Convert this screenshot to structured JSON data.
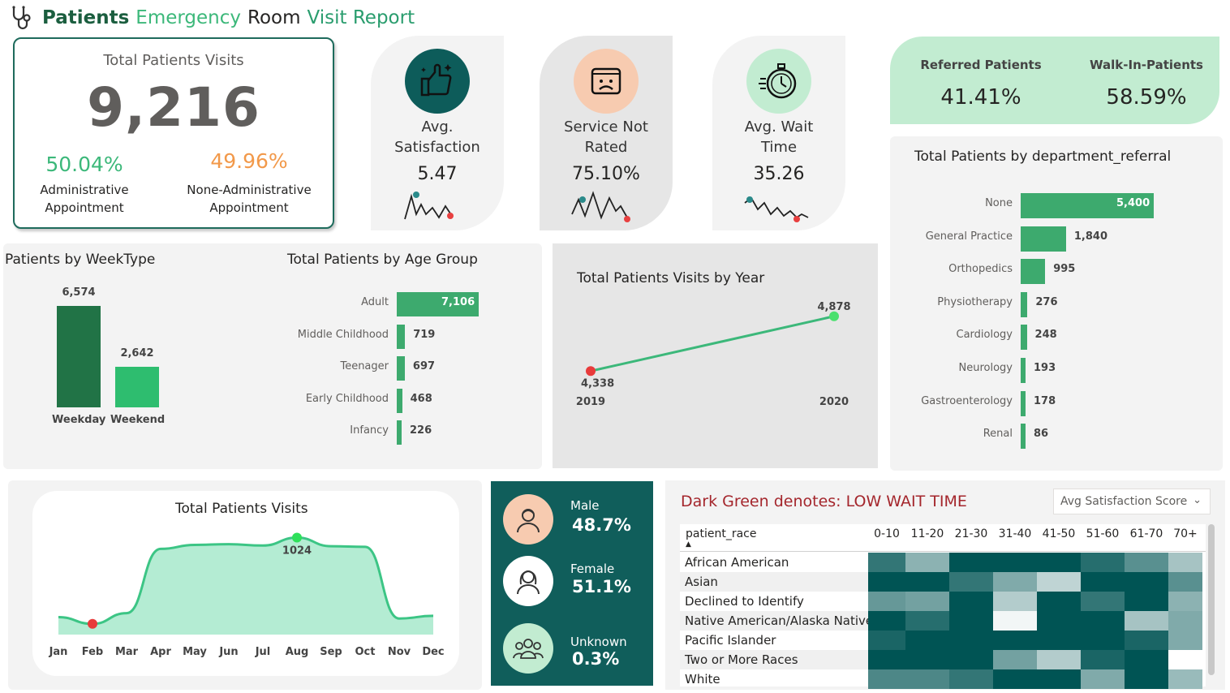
{
  "header": {
    "title_words": [
      "Patients",
      "Emergency",
      "Room",
      "Visit Report"
    ]
  },
  "total_card": {
    "title": "Total Patients Visits",
    "value": "9,216",
    "admin_pct": "50.04%",
    "admin_label_1": "Administrative",
    "admin_label_2": "Appointment",
    "nonadmin_pct": "49.96%",
    "nonadmin_label_1": "None-Administrative",
    "nonadmin_label_2": "Appointment",
    "colors": {
      "admin": "#3cb87a",
      "nonadmin": "#f2994a"
    }
  },
  "kpis": [
    {
      "label_1": "Avg.",
      "label_2": "Satisfaction",
      "value": "5.47",
      "icon": "thumbs-up-icon"
    },
    {
      "label_1": "Service Not",
      "label_2": "Rated",
      "value": "75.10%",
      "icon": "sad-face-icon"
    },
    {
      "label_1": "Avg. Wait",
      "label_2": "Time",
      "value": "35.26",
      "icon": "stopwatch-icon"
    }
  ],
  "referral_card": {
    "referred_label": "Referred Patients",
    "referred_value": "41.41%",
    "walkin_label": "Walk-In-Patients",
    "walkin_value": "58.59%"
  },
  "weektype": {
    "title": "Patients by WeekType",
    "chart_data": {
      "type": "bar",
      "categories": [
        "Weekday",
        "Weekend"
      ],
      "values": [
        6574,
        2642
      ],
      "value_labels": [
        "6,574",
        "2,642"
      ],
      "colors": [
        "#217346",
        "#2ebd6f"
      ]
    }
  },
  "age_group": {
    "title": "Total Patients by Age Group",
    "chart_data": {
      "type": "bar",
      "orientation": "horizontal",
      "categories": [
        "Adult",
        "Middle Childhood",
        "Teenager",
        "Early Childhood",
        "Infancy"
      ],
      "values": [
        7106,
        719,
        697,
        468,
        226
      ],
      "value_labels": [
        "7,106",
        "719",
        "697",
        "468",
        "226"
      ]
    }
  },
  "by_year": {
    "title": "Total Patients Visits by Year",
    "chart_data": {
      "type": "line",
      "x": [
        "2019",
        "2020"
      ],
      "values": [
        4338,
        4878
      ],
      "value_labels": [
        "4,338",
        "4,878"
      ]
    }
  },
  "dept_referral": {
    "title": "Total Patients by department_referral",
    "chart_data": {
      "type": "bar",
      "orientation": "horizontal",
      "categories": [
        "None",
        "General Practice",
        "Orthopedics",
        "Physiotherapy",
        "Cardiology",
        "Neurology",
        "Gastroenterology",
        "Renal"
      ],
      "values": [
        5400,
        1840,
        995,
        276,
        248,
        193,
        178,
        86
      ],
      "value_labels": [
        "5,400",
        "1,840",
        "995",
        "276",
        "248",
        "193",
        "178",
        "86"
      ]
    }
  },
  "monthly": {
    "title": "Total Patients Visits",
    "peak_label": "1024",
    "chart_data": {
      "type": "area",
      "x": [
        "Jan",
        "Feb",
        "Mar",
        "Apr",
        "May",
        "Jun",
        "Jul",
        "Aug",
        "Sep",
        "Oct",
        "Nov",
        "Dec"
      ],
      "values": [
        430,
        380,
        460,
        940,
        970,
        975,
        965,
        1024,
        960,
        955,
        420,
        440
      ]
    }
  },
  "gender": {
    "items": [
      {
        "label": "Male",
        "value": "48.7%",
        "icon": "male-avatar-icon"
      },
      {
        "label": "Female",
        "value": "51.1%",
        "icon": "female-avatar-icon"
      },
      {
        "label": "Unknown",
        "value": "0.3%",
        "icon": "group-icon"
      }
    ]
  },
  "heatmap": {
    "title": "Dark Green denotes: LOW WAIT TIME",
    "select_value": "Avg Satisfaction Score",
    "row_header": "patient_race",
    "chart_data": {
      "type": "heatmap",
      "columns": [
        "0-10",
        "11-20",
        "21-30",
        "31-40",
        "41-50",
        "51-60",
        "61-70",
        "70+"
      ],
      "rows": [
        "African American",
        "Asian",
        "Declined to Identify",
        "Native American/Alaska Native",
        "Pacific Islander",
        "Two or More Races",
        "White"
      ],
      "intensity": [
        [
          0.8,
          0.45,
          1.0,
          1.0,
          1.0,
          0.85,
          0.65,
          0.35
        ],
        [
          1.0,
          1.0,
          0.8,
          0.5,
          0.25,
          1.0,
          1.0,
          0.65
        ],
        [
          0.6,
          0.55,
          1.0,
          0.3,
          1.0,
          0.8,
          1.0,
          0.45
        ],
        [
          1.0,
          0.85,
          1.0,
          0.05,
          1.0,
          1.0,
          0.35,
          0.5
        ],
        [
          0.9,
          1.0,
          1.0,
          1.0,
          1.0,
          1.0,
          0.9,
          0.5
        ],
        [
          1.0,
          1.0,
          1.0,
          0.55,
          0.3,
          0.9,
          1.0,
          0.0
        ],
        [
          0.7,
          0.7,
          0.8,
          1.0,
          1.0,
          0.5,
          1.0,
          0.4
        ]
      ]
    }
  }
}
